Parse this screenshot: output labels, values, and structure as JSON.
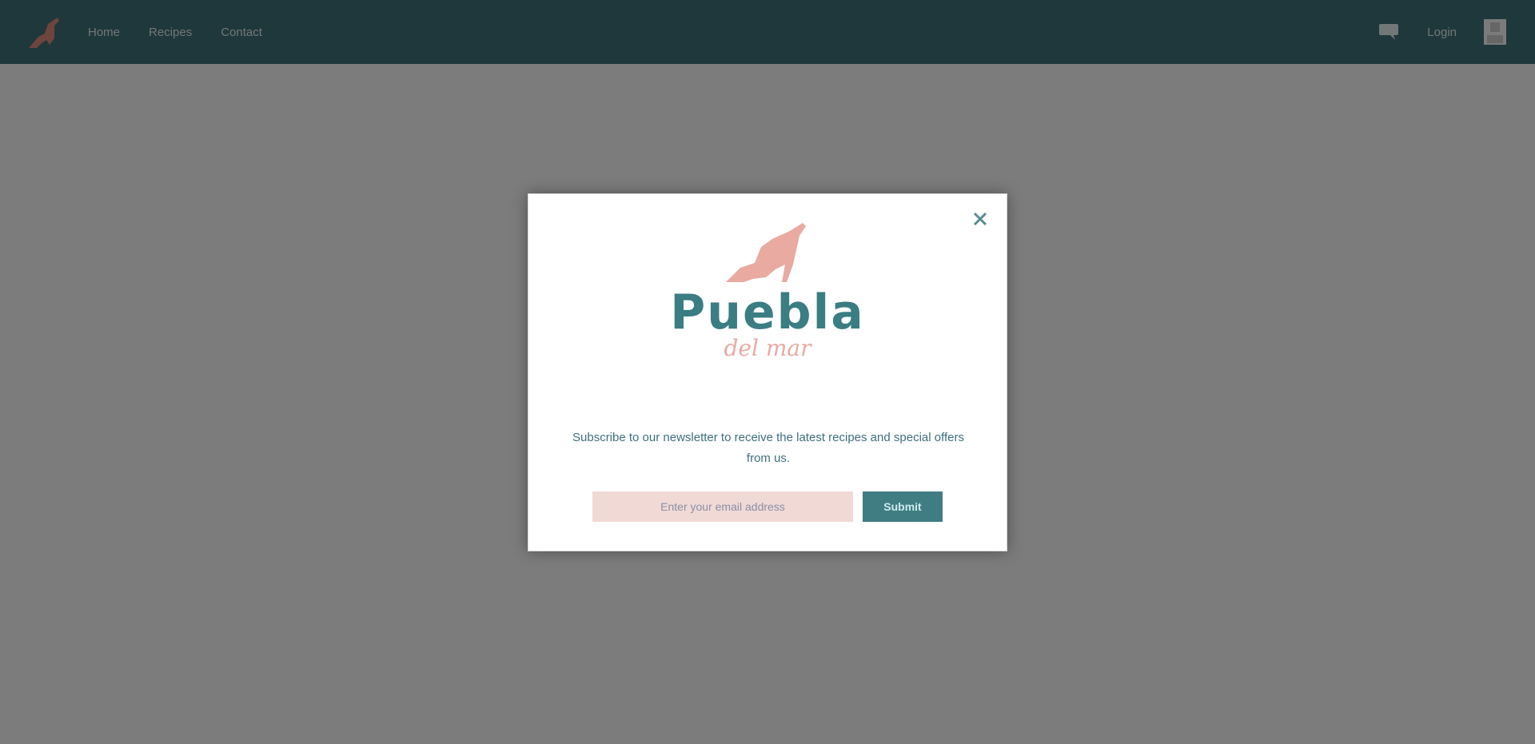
{
  "colors": {
    "topbar": "#3e6e74",
    "accent_teal": "#3a7d82",
    "accent_pink": "#e9aaa2",
    "input_bg": "#f1d9d6",
    "overlay": "rgba(0,0,0,0.49)"
  },
  "header": {
    "logo_icon": "dino-logo-icon",
    "nav": [
      "Home",
      "Recipes",
      "Contact"
    ],
    "right_icon": "chat-icon",
    "right_link": "Login",
    "account_icon": "user-icon"
  },
  "modal": {
    "close_icon": "close-icon",
    "brand_name": "Puebla",
    "brand_sub": "del mar",
    "message": "Subscribe to our newsletter to receive the latest recipes and special offers from us.",
    "email_placeholder": "Enter your email address",
    "submit_label": "Submit"
  }
}
